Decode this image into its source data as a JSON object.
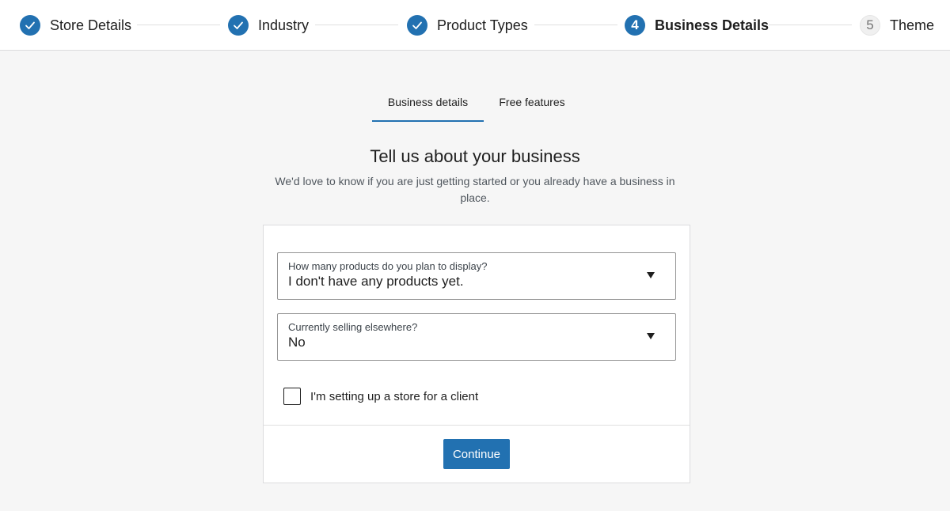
{
  "stepper": {
    "steps": [
      {
        "label": "Store Details",
        "state": "done",
        "icon": "check-icon"
      },
      {
        "label": "Industry",
        "state": "done",
        "icon": "check-icon"
      },
      {
        "label": "Product Types",
        "state": "done",
        "icon": "check-icon"
      },
      {
        "label": "Business Details",
        "state": "current",
        "number": "4"
      },
      {
        "label": "Theme",
        "state": "pending",
        "number": "5"
      }
    ]
  },
  "tabs": [
    {
      "label": "Business details",
      "active": true
    },
    {
      "label": "Free features",
      "active": false
    }
  ],
  "main": {
    "title": "Tell us about your business",
    "subtitle": "We'd love to know if you are just getting started or you already have a business in place."
  },
  "form": {
    "products_select": {
      "label": "How many products do you plan to display?",
      "value": "I don't have any products yet."
    },
    "selling_select": {
      "label": "Currently selling elsewhere?",
      "value": "No"
    },
    "client_checkbox": {
      "label": "I'm setting up a store for a client",
      "checked": false
    },
    "continue_label": "Continue"
  },
  "colors": {
    "accent": "#2271b1",
    "page_background": "#f6f6f6",
    "card_background": "#ffffff"
  }
}
